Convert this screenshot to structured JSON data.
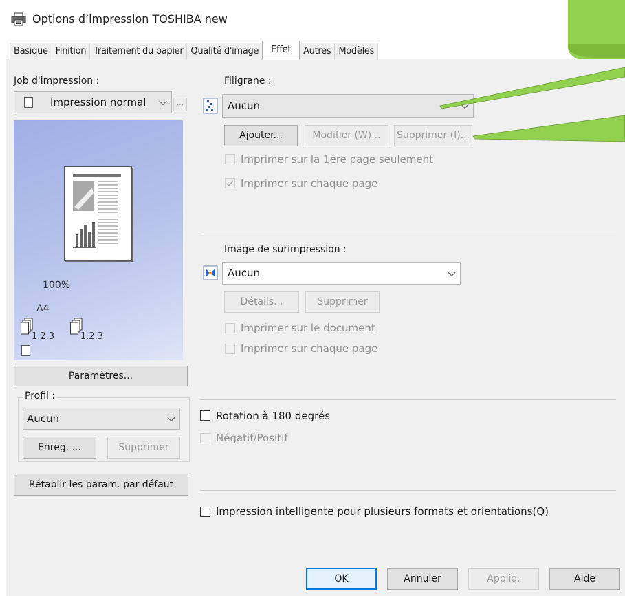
{
  "window": {
    "title": "Options d’impression TOSHIBA new"
  },
  "tabs": [
    "Basique",
    "Finition",
    "Traitement du papier",
    "Qualité d'image",
    "Effet",
    "Autres",
    "Modèles"
  ],
  "active_tab": "Effet",
  "left": {
    "job_label": "Job d'impression :",
    "job_value": "Impression normal",
    "more_button": "...",
    "zoom": "100%",
    "paper": "A4",
    "copies1": "1.2.3",
    "copies2": "1.2.3",
    "params_button": "Paramètres...",
    "profil_label": "Profil :",
    "profil_value": "Aucun",
    "save_button": "Enreg. ...",
    "delete_button": "Supprimer",
    "reset_button": "Rétablir les param. par défaut"
  },
  "filigrane": {
    "label": "Filigrane :",
    "value": "Aucun",
    "add_button": "Ajouter...",
    "modify_button": "Modifier (W)...",
    "delete_button": "Supprimer (I)...",
    "first_page_only": "Imprimer sur la 1ère page seulement",
    "each_page": "Imprimer sur chaque page"
  },
  "overlay": {
    "label": "Image de surimpression :",
    "value": "Aucun",
    "details_button": "Détails...",
    "delete_button": "Supprimer",
    "on_document": "Imprimer sur le document",
    "each_page": "Imprimer sur chaque page"
  },
  "rotation_label": "Rotation à 180 degrés",
  "negative_label": "Négatif/Positif",
  "smart_print_label": "Impression intelligente pour plusieurs formats et orientations(Q)",
  "footer": {
    "ok": "OK",
    "cancel": "Annuler",
    "apply": "Appliq.",
    "help": "Aide"
  },
  "colors": {
    "accent_green": "#92d050",
    "preview_blue": "#9fb0e6"
  }
}
